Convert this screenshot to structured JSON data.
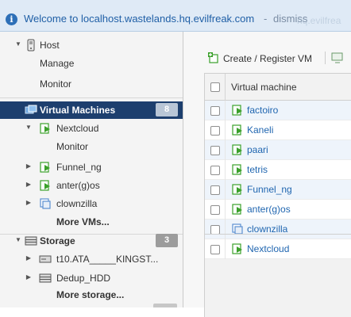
{
  "banner": {
    "message": "Welcome to localhost.wastelands.hq.evilfreak.com",
    "separator": "-",
    "dismiss": "dismiss",
    "ghost_text": "hq.evilfrea"
  },
  "nav": {
    "host": {
      "label": "Host",
      "items": [
        "Manage",
        "Monitor"
      ]
    },
    "virtual_machines": {
      "label": "Virtual Machines",
      "count": "8",
      "children": [
        {
          "label": "Nextcloud",
          "sub": [
            "Monitor"
          ]
        },
        {
          "label": "Funnel_ng"
        },
        {
          "label": "anter(g)os"
        },
        {
          "label": "clownzilla"
        }
      ],
      "more": "More VMs..."
    },
    "storage": {
      "label": "Storage",
      "count": "3",
      "children": [
        {
          "label": "t10.ATA_____KINGST..."
        },
        {
          "label": "Dedup_HDD"
        }
      ],
      "more": "More storage..."
    }
  },
  "toolbar": {
    "create_register": "Create / Register VM"
  },
  "table": {
    "column_header": "Virtual machine",
    "rows": [
      {
        "name": "factoiro",
        "state": "on"
      },
      {
        "name": "Kaneli",
        "state": "on"
      },
      {
        "name": "paari",
        "state": "on"
      },
      {
        "name": "tetris",
        "state": "on"
      },
      {
        "name": "Funnel_ng",
        "state": "on"
      },
      {
        "name": "anter(g)os",
        "state": "on"
      },
      {
        "name": "clownzilla",
        "state": "off"
      },
      {
        "name": "Nextcloud",
        "state": "on"
      }
    ]
  },
  "colors": {
    "selected_nav_bg": "#1d3f6e",
    "link_blue": "#2066b0",
    "vm_on_green": "#3aa02a",
    "banner_bg": "#dfeaf6"
  }
}
